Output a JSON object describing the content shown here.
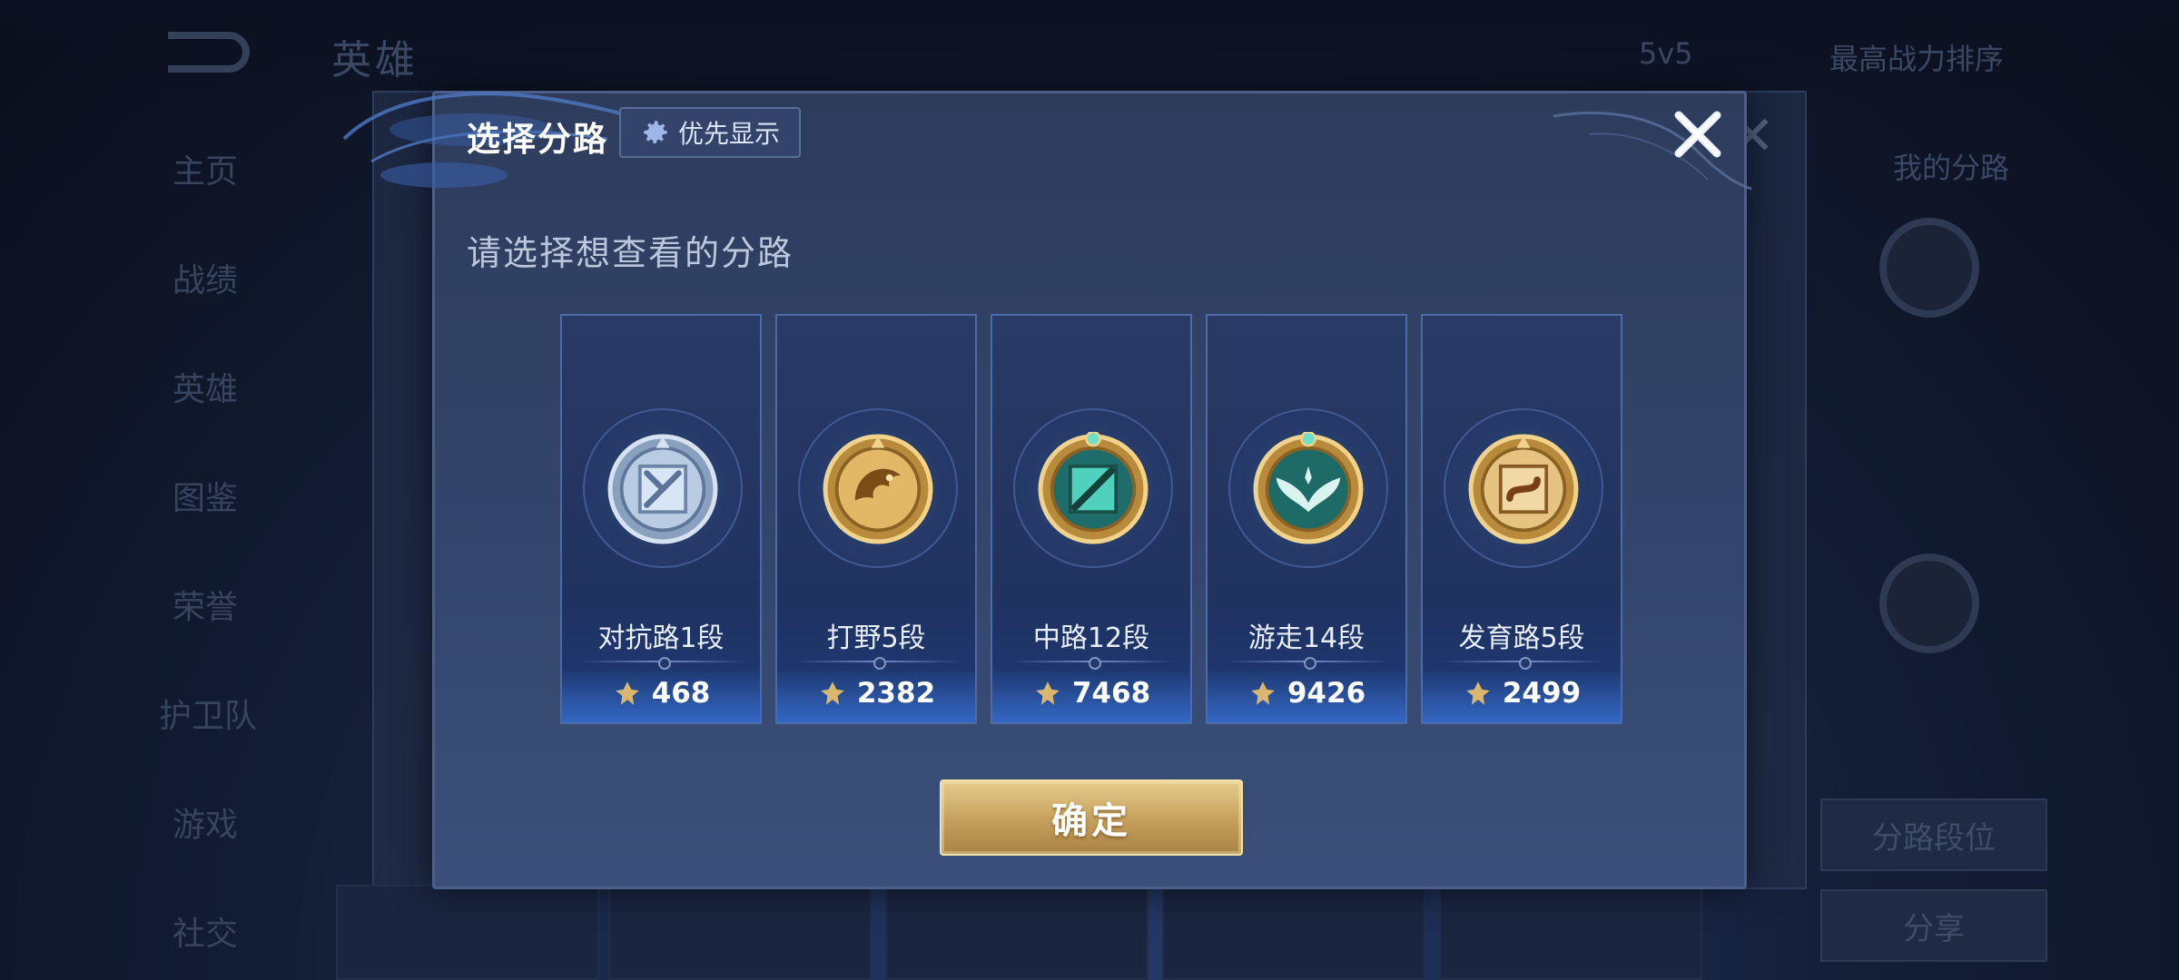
{
  "background": {
    "title": "英雄",
    "top_items": [
      "5v5",
      "最高战力排序"
    ],
    "nav": [
      "主页",
      "战绩",
      "英雄",
      "图鉴",
      "荣誉",
      "护卫队",
      "游戏",
      "社交"
    ],
    "right_labels": [
      "我的分路"
    ],
    "right_buttons": [
      "分路段位",
      "分享"
    ]
  },
  "modal": {
    "title": "选择分路",
    "priority_button": "优先显示",
    "subtitle": "请选择想查看的分路",
    "confirm_button": "确定"
  },
  "lanes": [
    {
      "name": "对抗路1段",
      "score": "468",
      "emblem": "clash-lane-emblem-icon",
      "color": "#b8c8dc"
    },
    {
      "name": "打野5段",
      "score": "2382",
      "emblem": "jungle-dragon-emblem-icon",
      "color": "#d6a64e"
    },
    {
      "name": "中路12段",
      "score": "7468",
      "emblem": "mid-lane-emblem-icon",
      "color": "#3fb7a6"
    },
    {
      "name": "游走14段",
      "score": "9426",
      "emblem": "roam-wings-emblem-icon",
      "color": "#3aa89a"
    },
    {
      "name": "发育路5段",
      "score": "2499",
      "emblem": "farm-lane-emblem-icon",
      "color": "#d8a55a"
    }
  ],
  "colors": {
    "modal_bg": "#2e3c5c",
    "accent_gold": "#c8a35f",
    "card_border": "#4d6ba8"
  }
}
